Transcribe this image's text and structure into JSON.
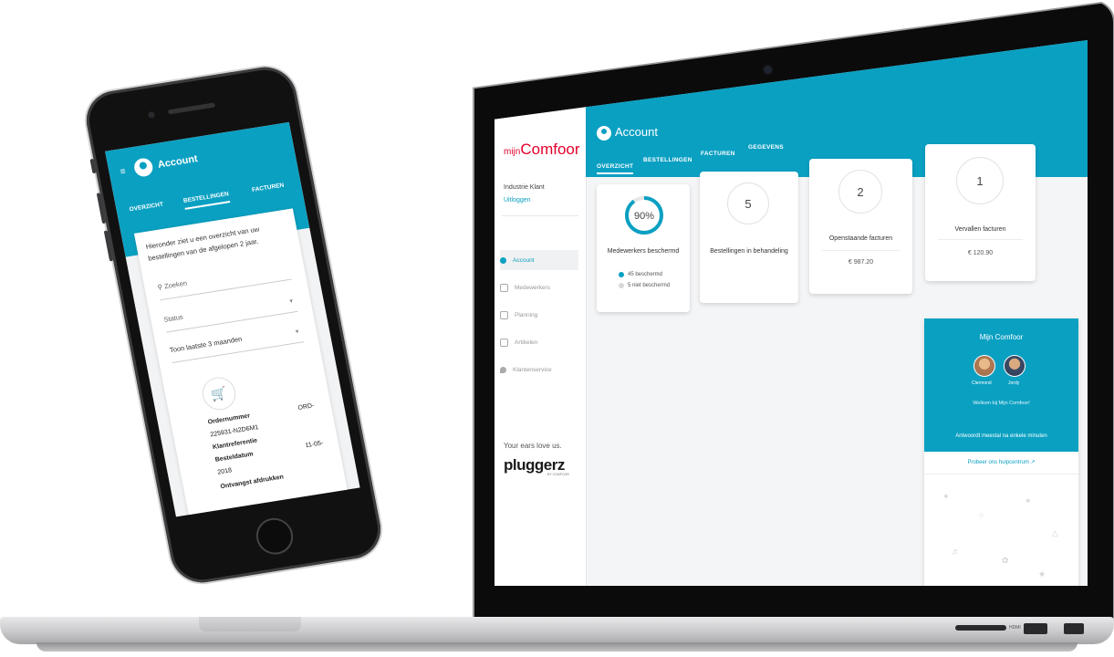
{
  "desktop": {
    "logo": {
      "prefix": "mijn",
      "brand": "Comfoor"
    },
    "user": {
      "name": "Industrie Klant",
      "logout": "Uitloggen"
    },
    "nav": [
      {
        "label": "Account",
        "icon": "user-icon",
        "active": true
      },
      {
        "label": "Medewerkers",
        "icon": "people-icon",
        "active": false
      },
      {
        "label": "Planning",
        "icon": "calendar-icon",
        "active": false
      },
      {
        "label": "Artikelen",
        "icon": "cart-icon",
        "active": false
      },
      {
        "label": "Klantenservice",
        "icon": "location-icon",
        "active": false
      }
    ],
    "tagline": "Your ears love us.",
    "partner": {
      "name": "pluggerz",
      "sub": "BY COMFOOR"
    },
    "header": {
      "title": "Account"
    },
    "tabs": [
      {
        "label": "OVERZICHT",
        "active": true
      },
      {
        "label": "BESTELLINGEN",
        "active": false
      },
      {
        "label": "FACTUREN",
        "active": false
      },
      {
        "label": "GEGEVENS",
        "active": false
      }
    ],
    "cards": {
      "protected": {
        "percent_label": "90%",
        "percent": 0.9,
        "label": "Medewerkers beschermd",
        "legend": [
          {
            "label": "45 beschermd",
            "color": "#0aa0c2"
          },
          {
            "label": "5 niet beschermd",
            "color": "#d8d8d8"
          }
        ]
      },
      "orders": {
        "value": "5",
        "label": "Bestellingen in behandeling"
      },
      "open_invoices": {
        "value": "2",
        "label": "Openstaande facturen",
        "amount": "€ 987.20"
      },
      "overdue_invoices": {
        "value": "1",
        "label": "Vervallen facturen",
        "amount": "€ 120.90"
      }
    },
    "widget": {
      "title": "Mijn Comfoor",
      "agents": [
        {
          "name": "Clermond"
        },
        {
          "name": "Jordy"
        }
      ],
      "welcome": "Welkom bij Mijn Comfoor!",
      "response": "Antwoordt meestal na enkele minuten",
      "help_link": "Probeer ons hulpcentrum"
    },
    "ports": {
      "hdmi": "HDMI"
    },
    "colors": {
      "accent": "#0aa0c2",
      "brand_red": "#e3002b"
    }
  },
  "mobile": {
    "header": {
      "title": "Account"
    },
    "tabs": [
      {
        "label": "OVERZICHT",
        "active": false
      },
      {
        "label": "BESTELLINGEN",
        "active": true
      },
      {
        "label": "FACTUREN",
        "active": false
      }
    ],
    "intro": "Hieronder ziet u een overzicht van uw bestellingen van de afgelopen 2 jaar.",
    "search_placeholder": "Zoeken",
    "status_placeholder": "Status",
    "period_select": "Toon laatste 3 maanden",
    "order": {
      "number_label": "Ordernummer",
      "number_value_prefix": "ORD-",
      "number_value": "225931-N2D6M1",
      "reference_label": "Klantreferentie",
      "date_label": "Besteldatum",
      "date_value_prefix": "11-05-",
      "date_value": "2018",
      "receipt_label": "Ontvangst afdrukken"
    }
  }
}
